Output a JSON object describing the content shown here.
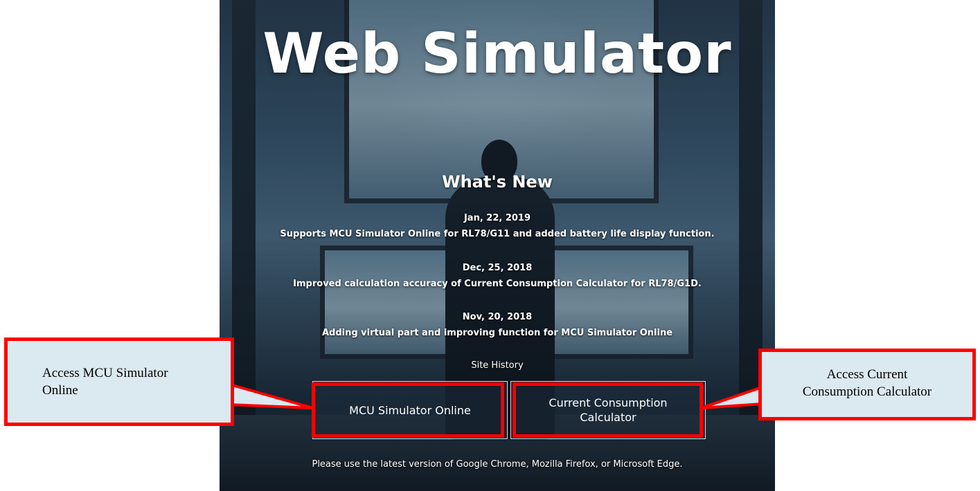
{
  "hero": {
    "title": "Web Simulator",
    "whats_new_heading": "What's New",
    "news": [
      {
        "date": "Jan, 22, 2019",
        "text": "Supports MCU Simulator Online for RL78/G11 and added battery life display function."
      },
      {
        "date": "Dec, 25, 2018",
        "text": "Improved calculation accuracy of Current Consumption Calculator for RL78/G1D."
      },
      {
        "date": "Nov, 20, 2018",
        "text": "Adding virtual part and improving function for MCU Simulator Online"
      }
    ],
    "site_history_link": "Site History",
    "buttons": {
      "mcu_simulator_online": "MCU Simulator Online",
      "current_consumption_calculator_line1": "Current Consumption",
      "current_consumption_calculator_line2": "Calculator"
    },
    "footer_note": "Please use the latest version of Google Chrome, Mozilla Firefox, or Microsoft Edge."
  },
  "annotations": {
    "left_callout_line1": "Access MCU Simulator",
    "left_callout_line2": "Online",
    "right_callout_line1": "Access Current",
    "right_callout_line2": "Consumption Calculator",
    "highlight_color": "#ff0000",
    "callout_fill": "#dbe9f1"
  }
}
